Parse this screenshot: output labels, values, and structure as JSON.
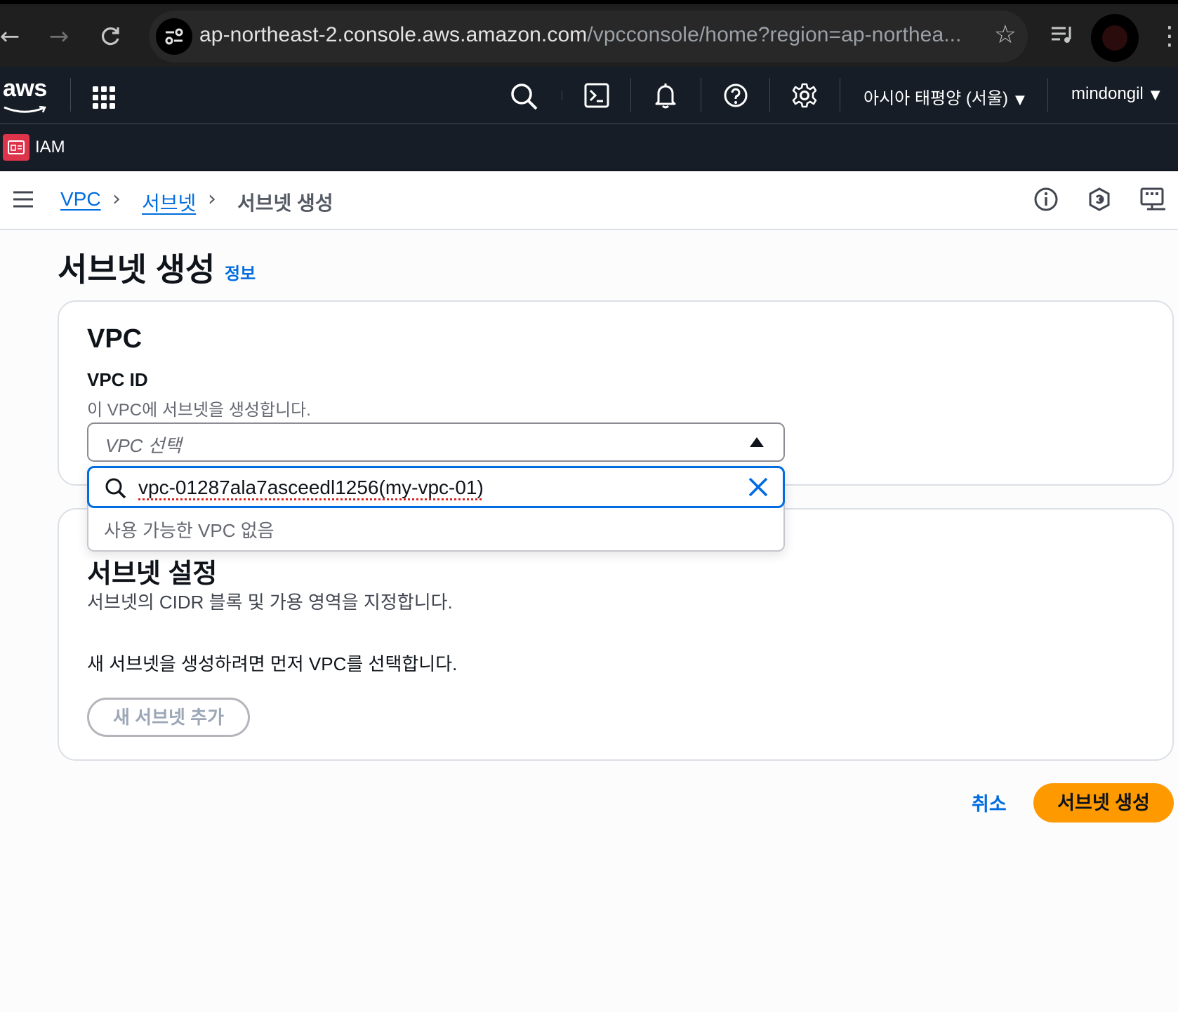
{
  "browser": {
    "url_host": "ap-northeast-2.console.aws.amazon.com",
    "url_path": "/vpcconsole/home?region=ap-northea..."
  },
  "aws_nav": {
    "logo_text": "aws",
    "region_label": "아시아 태평양 (서울)",
    "user_label": "mindongil"
  },
  "service_bar": {
    "service_label": "IAM",
    "service_color": "#dd344c"
  },
  "breadcrumb": {
    "items": [
      "VPC",
      "서브넷",
      "서브넷 생성"
    ]
  },
  "page": {
    "title": "서브넷 생성",
    "info_link": "정보"
  },
  "vpc_section": {
    "heading": "VPC",
    "field_label": "VPC ID",
    "field_description": "이 VPC에 서브넷을 생성합니다.",
    "select_placeholder": "VPC 선택",
    "filter_value": "vpc-01287ala7asceedl1256(my-vpc-01)",
    "empty_message": "사용 가능한 VPC 없음"
  },
  "subnet_section": {
    "heading": "서브넷 설정",
    "description": "서브넷의 CIDR 블록 및 가용 영역을 지정합니다.",
    "notice": "새 서브넷을 생성하려면 먼저 VPC를 선택합니다.",
    "add_button": "새 서브넷 추가"
  },
  "actions": {
    "cancel": "취소",
    "create": "서브넷 생성"
  },
  "colors": {
    "link": "#006ce0",
    "primary_button": "#ff9900",
    "nav_background": "#161d26"
  }
}
